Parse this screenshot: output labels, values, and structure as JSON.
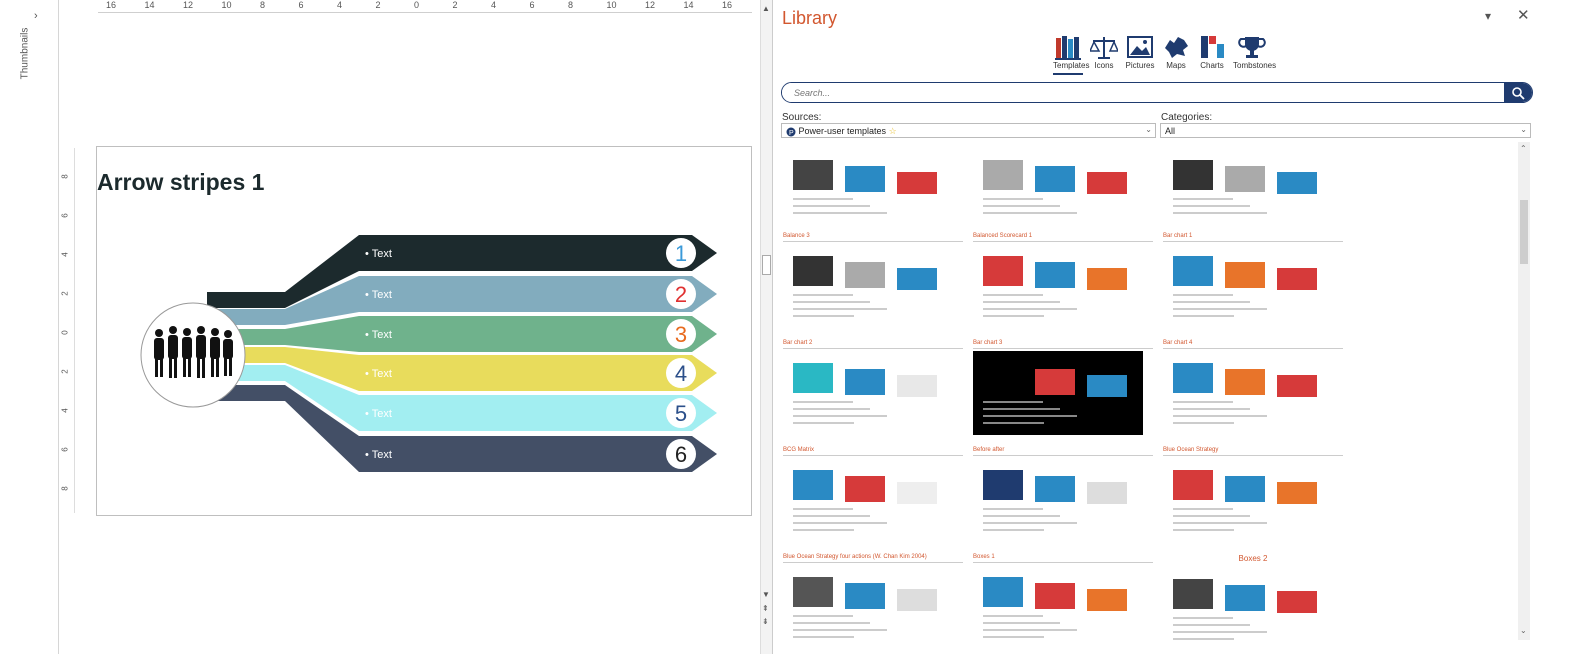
{
  "thumbnails": {
    "label": "Thumbnails",
    "chevron": "›"
  },
  "ruler": {
    "h_ticks": [
      "16",
      "14",
      "12",
      "10",
      "8",
      "6",
      "4",
      "2",
      "0",
      "2",
      "4",
      "6",
      "8",
      "10",
      "12",
      "14",
      "16"
    ],
    "v_ticks": [
      "8",
      "6",
      "4",
      "2",
      "0",
      "2",
      "4",
      "6",
      "8"
    ]
  },
  "slide": {
    "title": "Arrow stripes 1",
    "stripes": [
      {
        "label": "Text",
        "num": "1",
        "color": "#1c2a2d",
        "num_color": "#3a9ad9"
      },
      {
        "label": "Text",
        "num": "2",
        "color": "#82acbe",
        "num_color": "#e03030"
      },
      {
        "label": "Text",
        "num": "3",
        "color": "#6fb28c",
        "num_color": "#e86a1e"
      },
      {
        "label": "Text",
        "num": "4",
        "color": "#e8dc5c",
        "num_color": "#2b4f8a"
      },
      {
        "label": "Text",
        "num": "5",
        "color": "#a2eef1",
        "num_color": "#2b4f8a"
      },
      {
        "label": "Text",
        "num": "6",
        "color": "#434f66",
        "num_color": "#222222"
      }
    ]
  },
  "library": {
    "title": "Library",
    "dropdown_glyph": "▾",
    "close_glyph": "✕",
    "tabs": [
      {
        "label": "Templates",
        "icon": "books-icon",
        "active": true
      },
      {
        "label": "Icons",
        "icon": "scales-icon"
      },
      {
        "label": "Pictures",
        "icon": "picture-icon"
      },
      {
        "label": "Maps",
        "icon": "map-icon"
      },
      {
        "label": "Charts",
        "icon": "chart-icon"
      },
      {
        "label": "Tombstones",
        "icon": "trophy-icon"
      }
    ],
    "search_placeholder": "Search...",
    "sources_label": "Sources:",
    "sources_value": "Power-user templates",
    "categories_label": "Categories:",
    "categories_value": "All",
    "templates": [
      {
        "title": ""
      },
      {
        "title": ""
      },
      {
        "title": ""
      },
      {
        "title": "Balance 3"
      },
      {
        "title": "Balanced Scorecard 1"
      },
      {
        "title": "Bar chart 1"
      },
      {
        "title": "Bar chart 2"
      },
      {
        "title": "Bar chart 3"
      },
      {
        "title": "Bar chart 4"
      },
      {
        "title": "BCG Matrix"
      },
      {
        "title": "Before after"
      },
      {
        "title": "Blue Ocean Strategy"
      },
      {
        "title": "Blue Ocean Strategy four actions (W. Chan Kim 2004)"
      },
      {
        "title": "Boxes 1"
      },
      {
        "title": "Boxes 2"
      }
    ]
  },
  "colors": {
    "accent": "#d2572f",
    "navy": "#1f3b6f"
  }
}
